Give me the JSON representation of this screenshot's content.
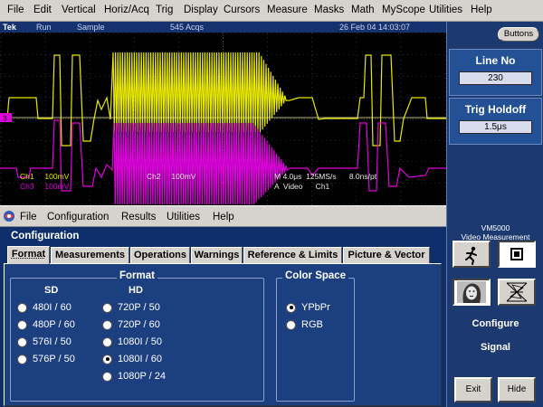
{
  "menubar": {
    "items": [
      "File",
      "Edit",
      "Vertical",
      "Horiz/Acq",
      "Trig",
      "Display",
      "Cursors",
      "Measure",
      "Masks",
      "Math",
      "MyScope",
      "Utilities",
      "Help"
    ]
  },
  "status": {
    "brand": "Tek",
    "state": "Run",
    "mode": "Sample",
    "acqs": "545 Acqs",
    "datetime": "26 Feb 04 14:03:07"
  },
  "scope": {
    "ch1_scale": "Ch1     100mV",
    "ch2_scale": "Ch2     100mV",
    "ch3_scale": "Ch3     100mV",
    "timebase": "M 4.0μs  125MS/s      8.0ns/pt",
    "trigger": "A  Video      Ch1",
    "marker_channel": "3",
    "trace_colors": {
      "ch1": "#e8e800",
      "ch3": "#e000e0"
    }
  },
  "right_panel": {
    "buttons_label": "Buttons",
    "line_no": {
      "title": "Line No",
      "value": "230"
    },
    "trig_holdoff": {
      "title": "Trig Holdoff",
      "value": "1.5μs"
    }
  },
  "app": {
    "menu": [
      "File",
      "Configuration",
      "Results",
      "Utilities",
      "Help"
    ],
    "title": "Configuration",
    "tabs": [
      "Format",
      "Measurements",
      "Operations",
      "Warnings",
      "Reference & Limits",
      "Picture & Vector"
    ],
    "active_tab": "Format",
    "format_group": {
      "title": "Format",
      "sd_header": "SD",
      "hd_header": "HD",
      "sd_options": [
        "480I / 60",
        "480P / 60",
        "576I / 50",
        "576P / 50"
      ],
      "hd_options": [
        "720P / 50",
        "720P / 60",
        "1080I / 50",
        "1080I / 60",
        "1080P / 24"
      ],
      "selected": "1080I / 60"
    },
    "color_space_group": {
      "title": "Color Space",
      "options": [
        "YPbPr",
        "RGB"
      ],
      "selected": "YPbPr"
    }
  },
  "vm_panel": {
    "title_line1": "VM5000",
    "title_line2": "Video Measurement",
    "configure_label": "Configure",
    "signal_label": "Signal",
    "exit_label": "Exit",
    "hide_label": "Hide",
    "icons": [
      "runner-icon",
      "stop-square-icon",
      "face-image-icon",
      "vectorscope-icon"
    ]
  }
}
